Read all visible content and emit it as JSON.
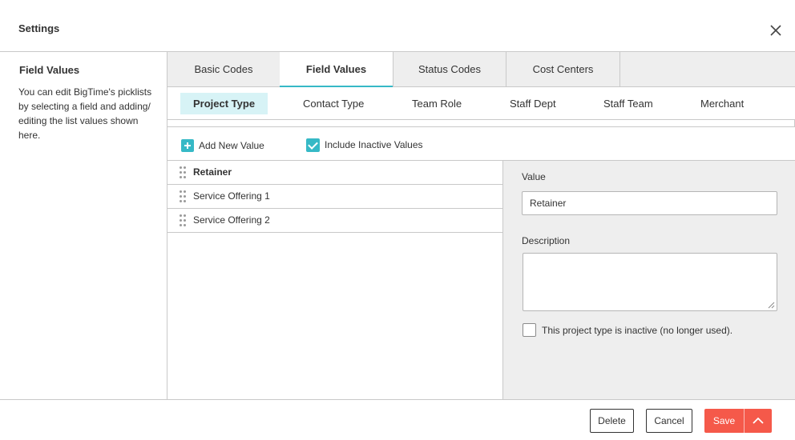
{
  "header": {
    "title": "Settings"
  },
  "sidebar": {
    "heading": "Field Values",
    "description": "You can edit BigTime's picklists by selecting a field and adding/ editing the list values shown here."
  },
  "tabs": [
    {
      "label": "Basic Codes"
    },
    {
      "label": "Field Values"
    },
    {
      "label": "Status Codes"
    },
    {
      "label": "Cost Centers"
    }
  ],
  "subtabs": [
    {
      "label": "Project Type"
    },
    {
      "label": "Contact Type"
    },
    {
      "label": "Team Role"
    },
    {
      "label": "Staff Dept"
    },
    {
      "label": "Staff Team"
    },
    {
      "label": "Merchant"
    }
  ],
  "toolbar": {
    "add_label": "Add New Value",
    "include_inactive_label": "Include Inactive Values"
  },
  "list": {
    "items": [
      {
        "label": "Retainer"
      },
      {
        "label": "Service Offering 1"
      },
      {
        "label": "Service Offering 2"
      }
    ]
  },
  "detail": {
    "value_label": "Value",
    "value": "Retainer",
    "description_label": "Description",
    "description_value": "",
    "inactive_label": "This project type is inactive (no longer used)."
  },
  "footer": {
    "delete_label": "Delete",
    "cancel_label": "Cancel",
    "save_label": "Save"
  },
  "colors": {
    "accent": "#36b9c6",
    "save": "#f5594a",
    "active_subtab_bg": "#d7f3f6",
    "panel_bg": "#eeeeee"
  }
}
